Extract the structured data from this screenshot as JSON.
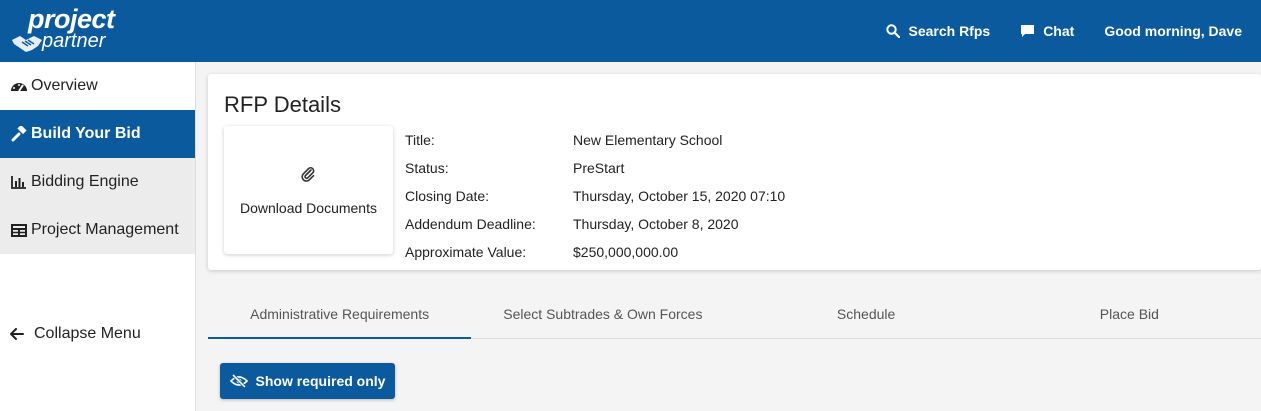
{
  "brand": {
    "line1": "project",
    "line2": "partner"
  },
  "header": {
    "search_label": "Search Rfps",
    "chat_label": "Chat",
    "greeting": "Good morning, Dave"
  },
  "sidebar": {
    "items": [
      {
        "label": "Overview",
        "icon": "dashboard-icon"
      },
      {
        "label": "Build Your Bid",
        "icon": "hammer-icon",
        "active": true
      },
      {
        "label": "Bidding Engine",
        "icon": "bar-chart-icon"
      },
      {
        "label": "Project Management",
        "icon": "table-icon"
      }
    ],
    "collapse_label": "Collapse Menu"
  },
  "rfp": {
    "heading": "RFP Details",
    "download_label": "Download Documents",
    "fields": [
      {
        "label": "Title:",
        "value": "New Elementary School"
      },
      {
        "label": "Status:",
        "value": "PreStart"
      },
      {
        "label": "Closing Date:",
        "value": "Thursday, October 15, 2020 07:10"
      },
      {
        "label": "Addendum Deadline:",
        "value": "Thursday, October 8, 2020"
      },
      {
        "label": "Approximate Value:",
        "value": "$250,000,000.00"
      }
    ]
  },
  "tabs": [
    {
      "label": "Administrative Requirements",
      "active": true
    },
    {
      "label": "Select Subtrades & Own Forces"
    },
    {
      "label": "Schedule"
    },
    {
      "label": "Place Bid"
    }
  ],
  "filter_button_label": "Show required only",
  "colors": {
    "primary": "#0b5a9e",
    "sidebar_bg": "#ececec",
    "page_bg": "#f4f4f4"
  }
}
